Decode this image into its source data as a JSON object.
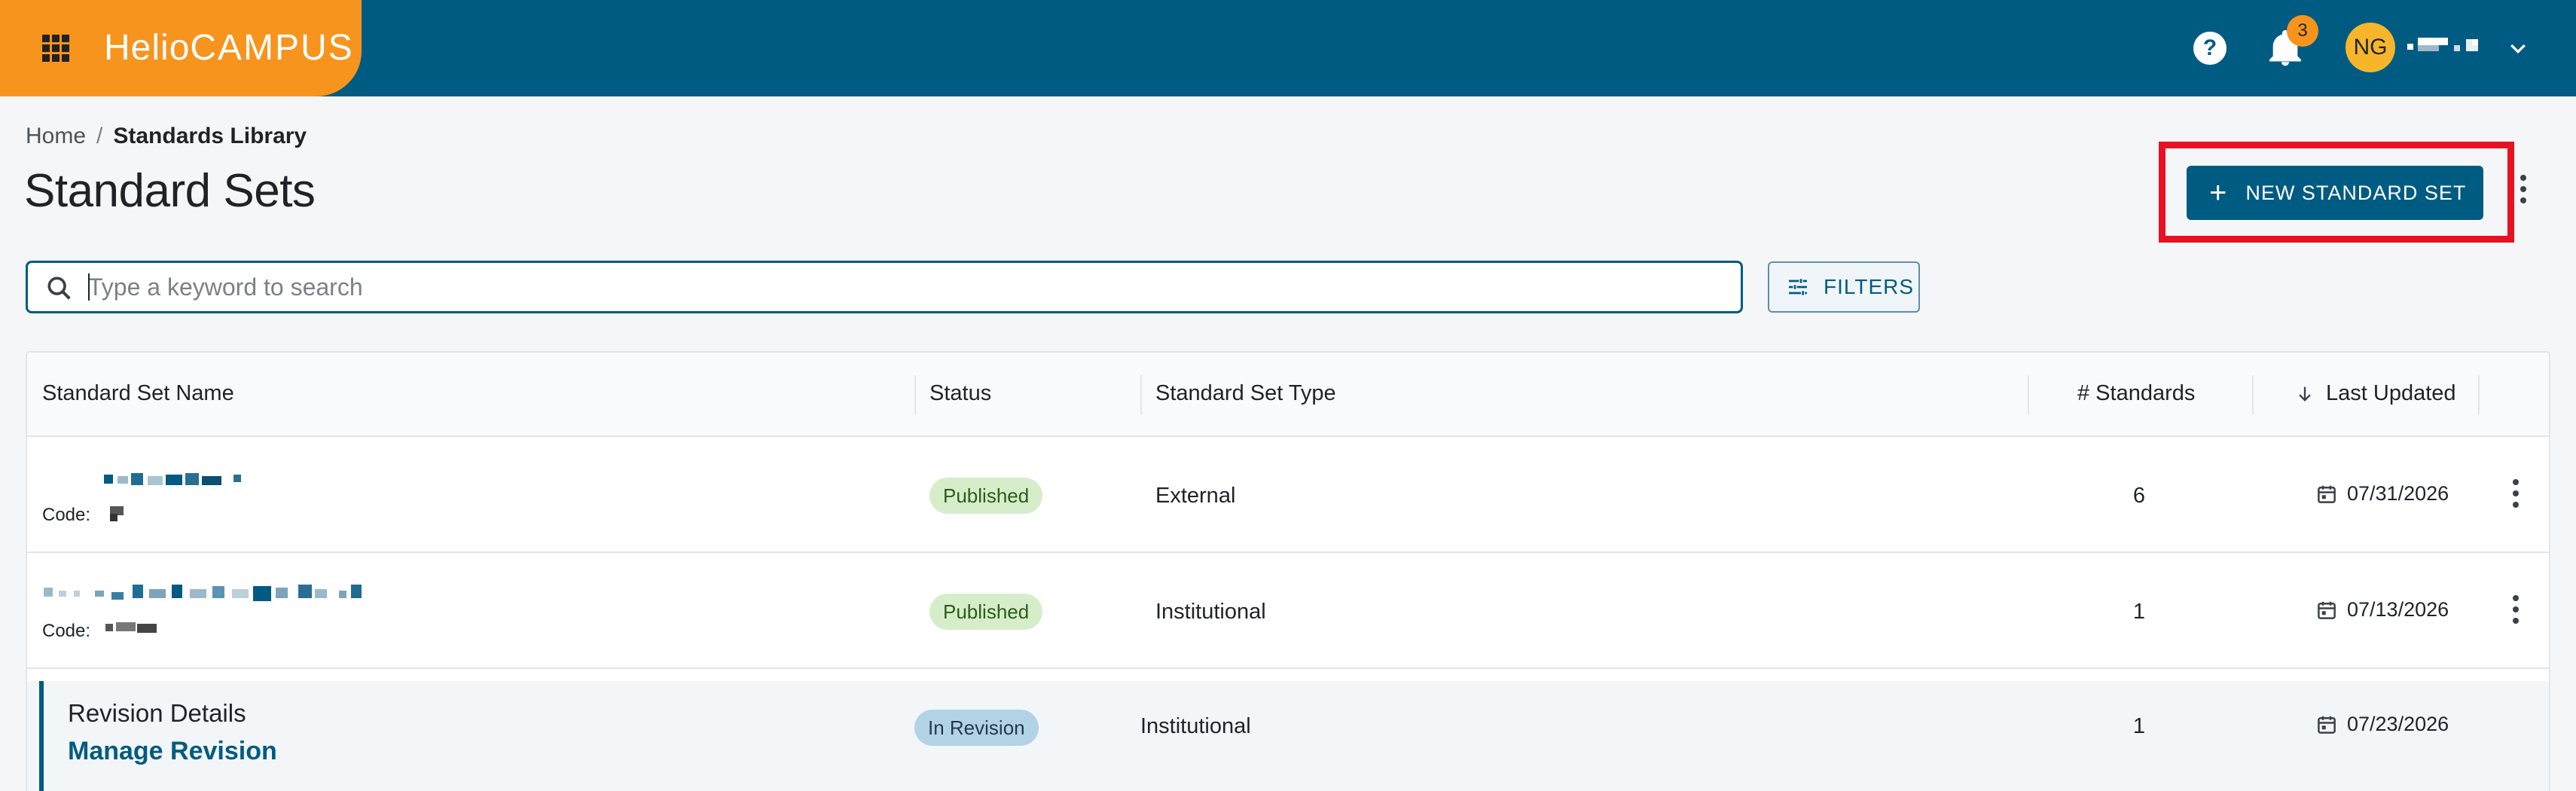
{
  "app": {
    "logo_main": "Helio",
    "logo_sub": "CAMPUS",
    "notification_count": "3",
    "avatar_initials": "NG"
  },
  "breadcrumb": {
    "home": "Home",
    "separator": "/",
    "current": "Standards Library"
  },
  "page": {
    "title": "Standard Sets",
    "new_button_label": "NEW STANDARD SET"
  },
  "search": {
    "placeholder": "Type a keyword to search",
    "value": ""
  },
  "filters": {
    "label": "FILTERS"
  },
  "table": {
    "columns": {
      "name": "Standard Set Name",
      "status": "Status",
      "type": "Standard Set Type",
      "count": "# Standards",
      "updated": "Last Updated"
    },
    "code_label": "Code:",
    "rows": [
      {
        "status": "Published",
        "type": "External",
        "count": "6",
        "updated": "07/31/2026"
      },
      {
        "status": "Published",
        "type": "Institutional",
        "count": "1",
        "updated": "07/13/2026"
      }
    ],
    "revision_row": {
      "title": "Revision Details",
      "link": "Manage Revision",
      "status": "In Revision",
      "type": "Institutional",
      "count": "1",
      "updated": "07/23/2026"
    }
  },
  "colors": {
    "header_bg": "#005b82",
    "brand_orange": "#f7941d",
    "highlight_red": "#e81123",
    "published_bg": "#d5eec9",
    "revision_bg": "#b2d2e6"
  },
  "icons": [
    "apps-grid-icon",
    "help-icon",
    "bell-icon",
    "chevron-down-icon",
    "plus-icon",
    "more-vertical-icon",
    "search-icon",
    "filter-icon",
    "arrow-down-icon",
    "calendar-icon"
  ]
}
